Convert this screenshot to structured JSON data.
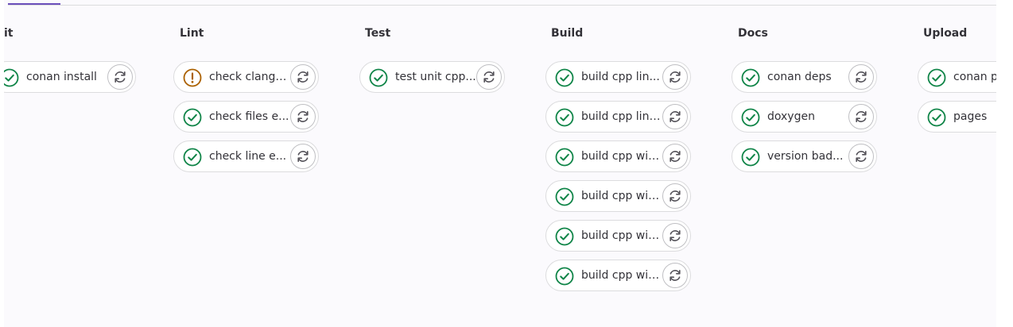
{
  "colors": {
    "success": "#108548",
    "warning": "#ab6100",
    "accent": "#6b4fbb",
    "border": "#dcdcde"
  },
  "icons": {
    "success": "status-success-icon",
    "warning": "status-warning-icon",
    "retry": "retry-icon"
  },
  "stages": [
    {
      "title": "it",
      "jobs": [
        {
          "name": "conan install",
          "status": "success"
        }
      ]
    },
    {
      "title": "Lint",
      "jobs": [
        {
          "name": "check clang-fo...",
          "status": "warning"
        },
        {
          "name": "check files e...",
          "status": "success"
        },
        {
          "name": "check line e...",
          "status": "success"
        }
      ]
    },
    {
      "title": "Test",
      "jobs": [
        {
          "name": "test unit cpp...",
          "status": "success"
        }
      ]
    },
    {
      "title": "Build",
      "jobs": [
        {
          "name": "build cpp lin...",
          "status": "success"
        },
        {
          "name": "build cpp linu...",
          "status": "success"
        },
        {
          "name": "build cpp wind...",
          "status": "success"
        },
        {
          "name": "build cpp wind...",
          "status": "success"
        },
        {
          "name": "build cpp wind...",
          "status": "success"
        },
        {
          "name": "build cpp wind...",
          "status": "success"
        }
      ]
    },
    {
      "title": "Docs",
      "jobs": [
        {
          "name": "conan deps",
          "status": "success"
        },
        {
          "name": "doxygen",
          "status": "success"
        },
        {
          "name": "version bad...",
          "status": "success"
        }
      ]
    },
    {
      "title": "Upload",
      "jobs": [
        {
          "name": "conan pa",
          "status": "success"
        },
        {
          "name": "pages",
          "status": "success"
        }
      ]
    }
  ]
}
